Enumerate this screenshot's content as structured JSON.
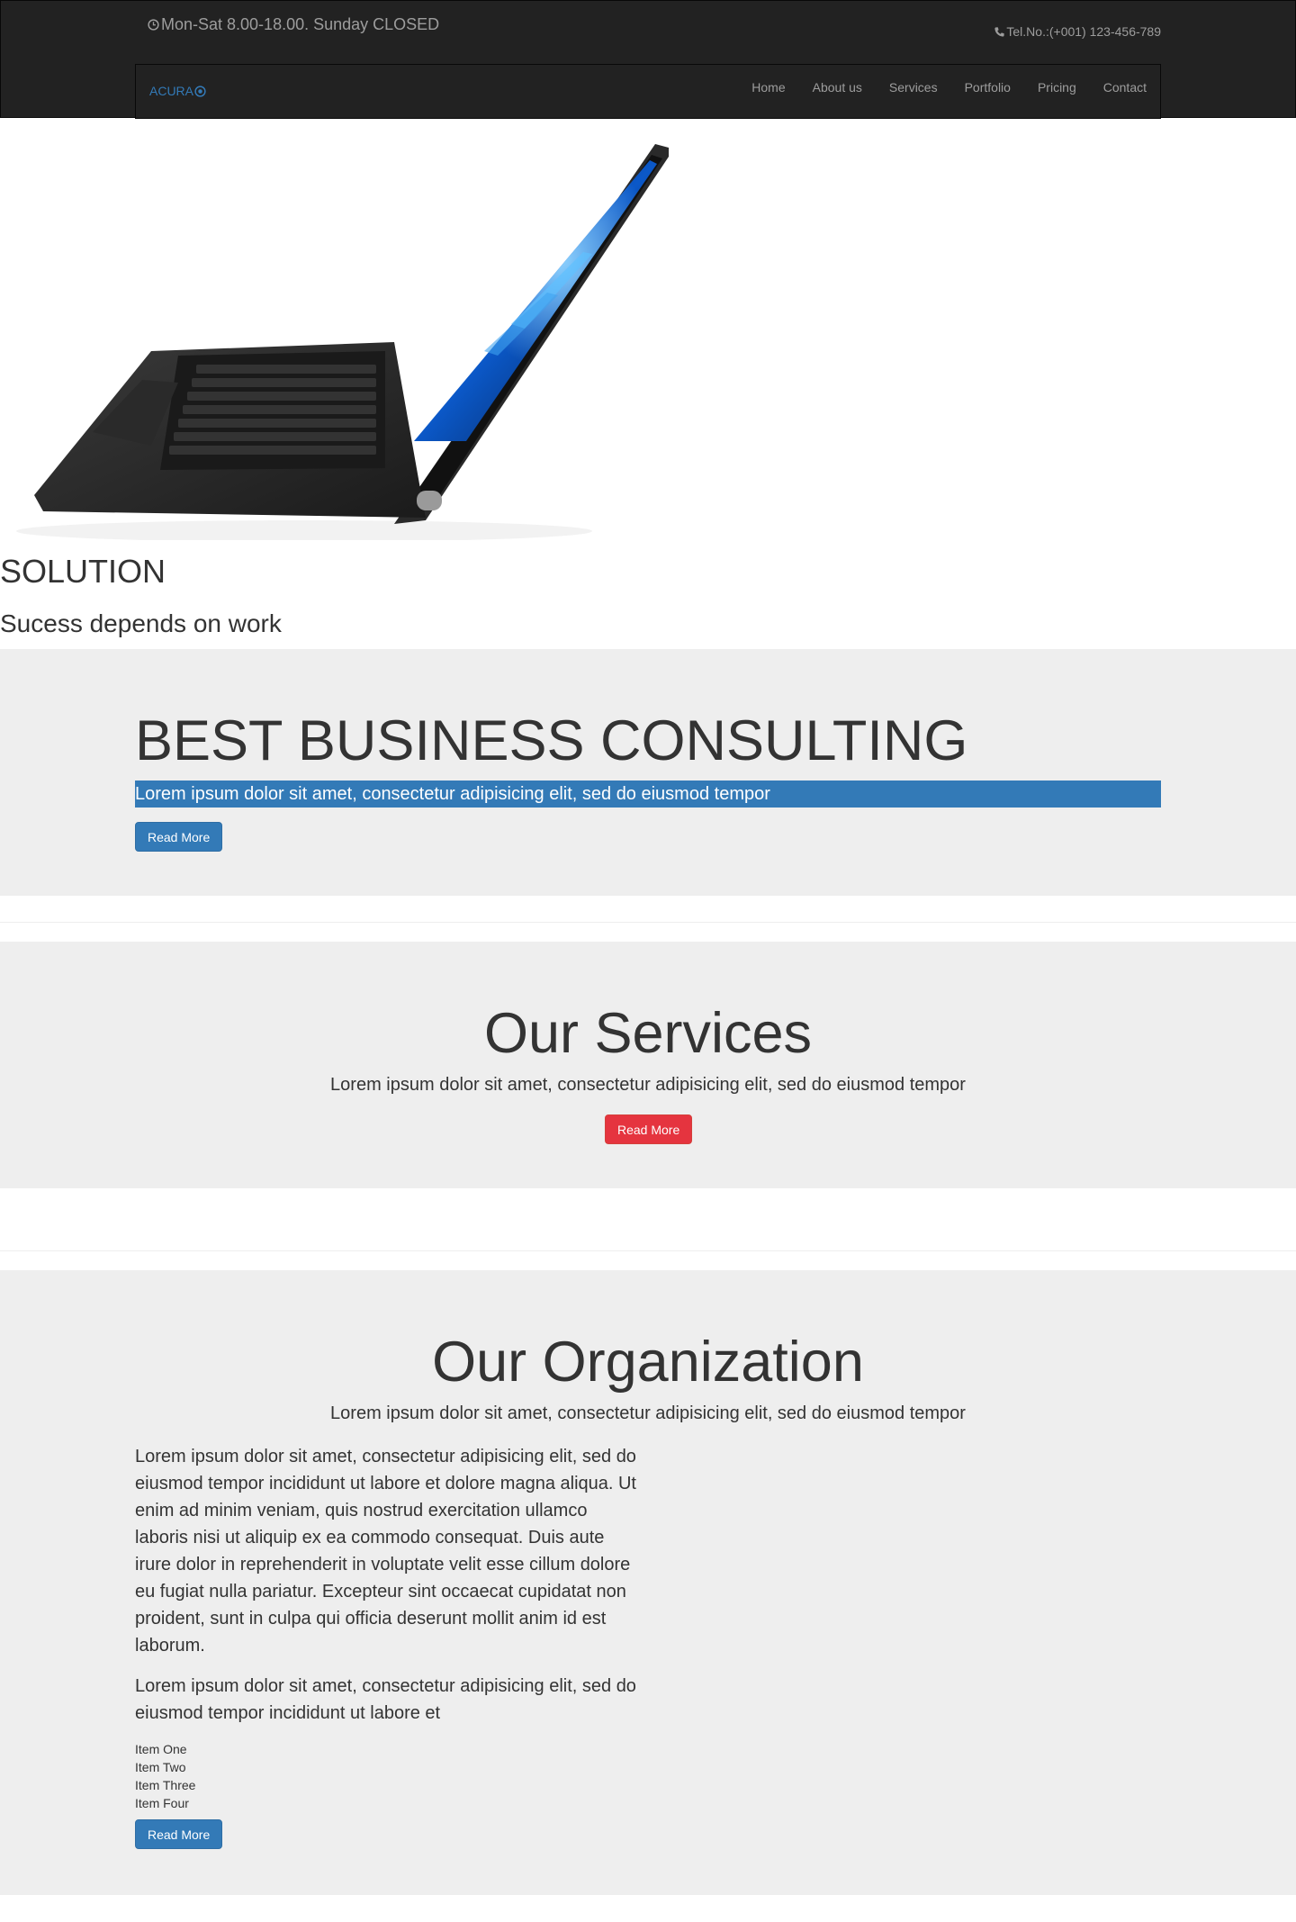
{
  "header": {
    "hours": "Mon-Sat 8.00-18.00. Sunday CLOSED",
    "tel": "Tel.No.:(+001) 123-456-789",
    "brand": "ACURA",
    "nav": [
      "Home",
      "About us",
      "Services",
      "Portfolio",
      "Pricing",
      "Contact"
    ]
  },
  "hero": {
    "title": "SOLUTION",
    "subtitle": "Sucess depends on work"
  },
  "jumbotron": {
    "title": "BEST BUSINESS CONSULTING",
    "text": "Lorem ipsum dolor sit amet, consectetur adipisicing elit, sed do eiusmod tempor",
    "button": "Read More"
  },
  "services": {
    "title": "Our Services",
    "lead": "Lorem ipsum dolor sit amet, consectetur adipisicing elit, sed do eiusmod tempor",
    "button": "Read More"
  },
  "organization": {
    "title": "Our Organization",
    "lead": "Lorem ipsum dolor sit amet, consectetur adipisicing elit, sed do eiusmod tempor",
    "paragraph1": "Lorem ipsum dolor sit amet, consectetur adipisicing elit, sed do eiusmod tempor incididunt ut labore et dolore magna aliqua. Ut enim ad minim veniam, quis nostrud exercitation ullamco laboris nisi ut aliquip ex ea commodo consequat. Duis aute irure dolor in reprehenderit in voluptate velit esse cillum dolore eu fugiat nulla pariatur. Excepteur sint occaecat cupidatat non proident, sunt in culpa qui officia deserunt mollit anim id est laborum.",
    "paragraph2": "Lorem ipsum dolor sit amet, consectetur adipisicing elit, sed do eiusmod tempor incididunt ut labore et",
    "items": [
      "Item One",
      "Item Two",
      "Item Three",
      "Item Four"
    ],
    "button": "Read More"
  },
  "colors": {
    "header_bg": "#222222",
    "section_bg": "#eeeeee",
    "primary": "#337ab7",
    "danger": "#e5343f",
    "nav_text": "#9d9d9d"
  },
  "icons": {
    "hours": "clock-icon",
    "tel": "phone-icon",
    "brand": "logo-circle-icon"
  }
}
